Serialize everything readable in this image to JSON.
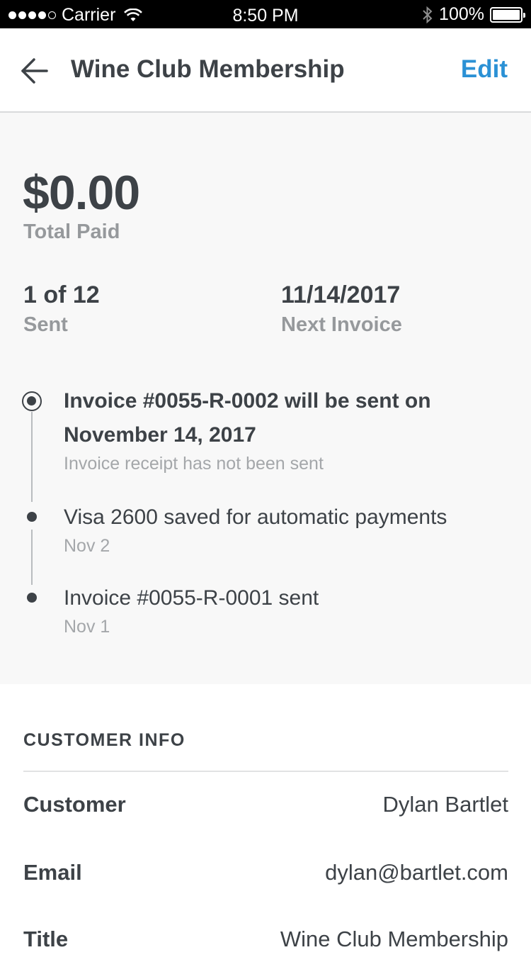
{
  "status_bar": {
    "carrier": "Carrier",
    "time": "8:50 PM",
    "battery": "100%"
  },
  "nav": {
    "title": "Wine Club Membership",
    "edit_label": "Edit",
    "accent_color": "#2b91d5"
  },
  "summary": {
    "amount": "$0.00",
    "amount_label": "Total Paid",
    "sent_value": "1 of 12",
    "sent_label": "Sent",
    "next_value": "11/14/2017",
    "next_label": "Next Invoice"
  },
  "timeline": [
    {
      "title_line1": "Invoice #0055-R-0002 will be sent on",
      "title_line2": "November 14, 2017",
      "subtitle": "Invoice receipt has not been sent"
    },
    {
      "title": "Visa 2600 saved for automatic payments",
      "subtitle": "Nov 2"
    },
    {
      "title": "Invoice #0055-R-0001 sent",
      "subtitle": "Nov 1"
    }
  ],
  "customer_info": {
    "header": "CUSTOMER INFO",
    "rows": [
      {
        "label": "Customer",
        "value": "Dylan Bartlet"
      },
      {
        "label": "Email",
        "value": "dylan@bartlet.com"
      },
      {
        "label": "Title",
        "value": "Wine Club Membership"
      }
    ]
  }
}
